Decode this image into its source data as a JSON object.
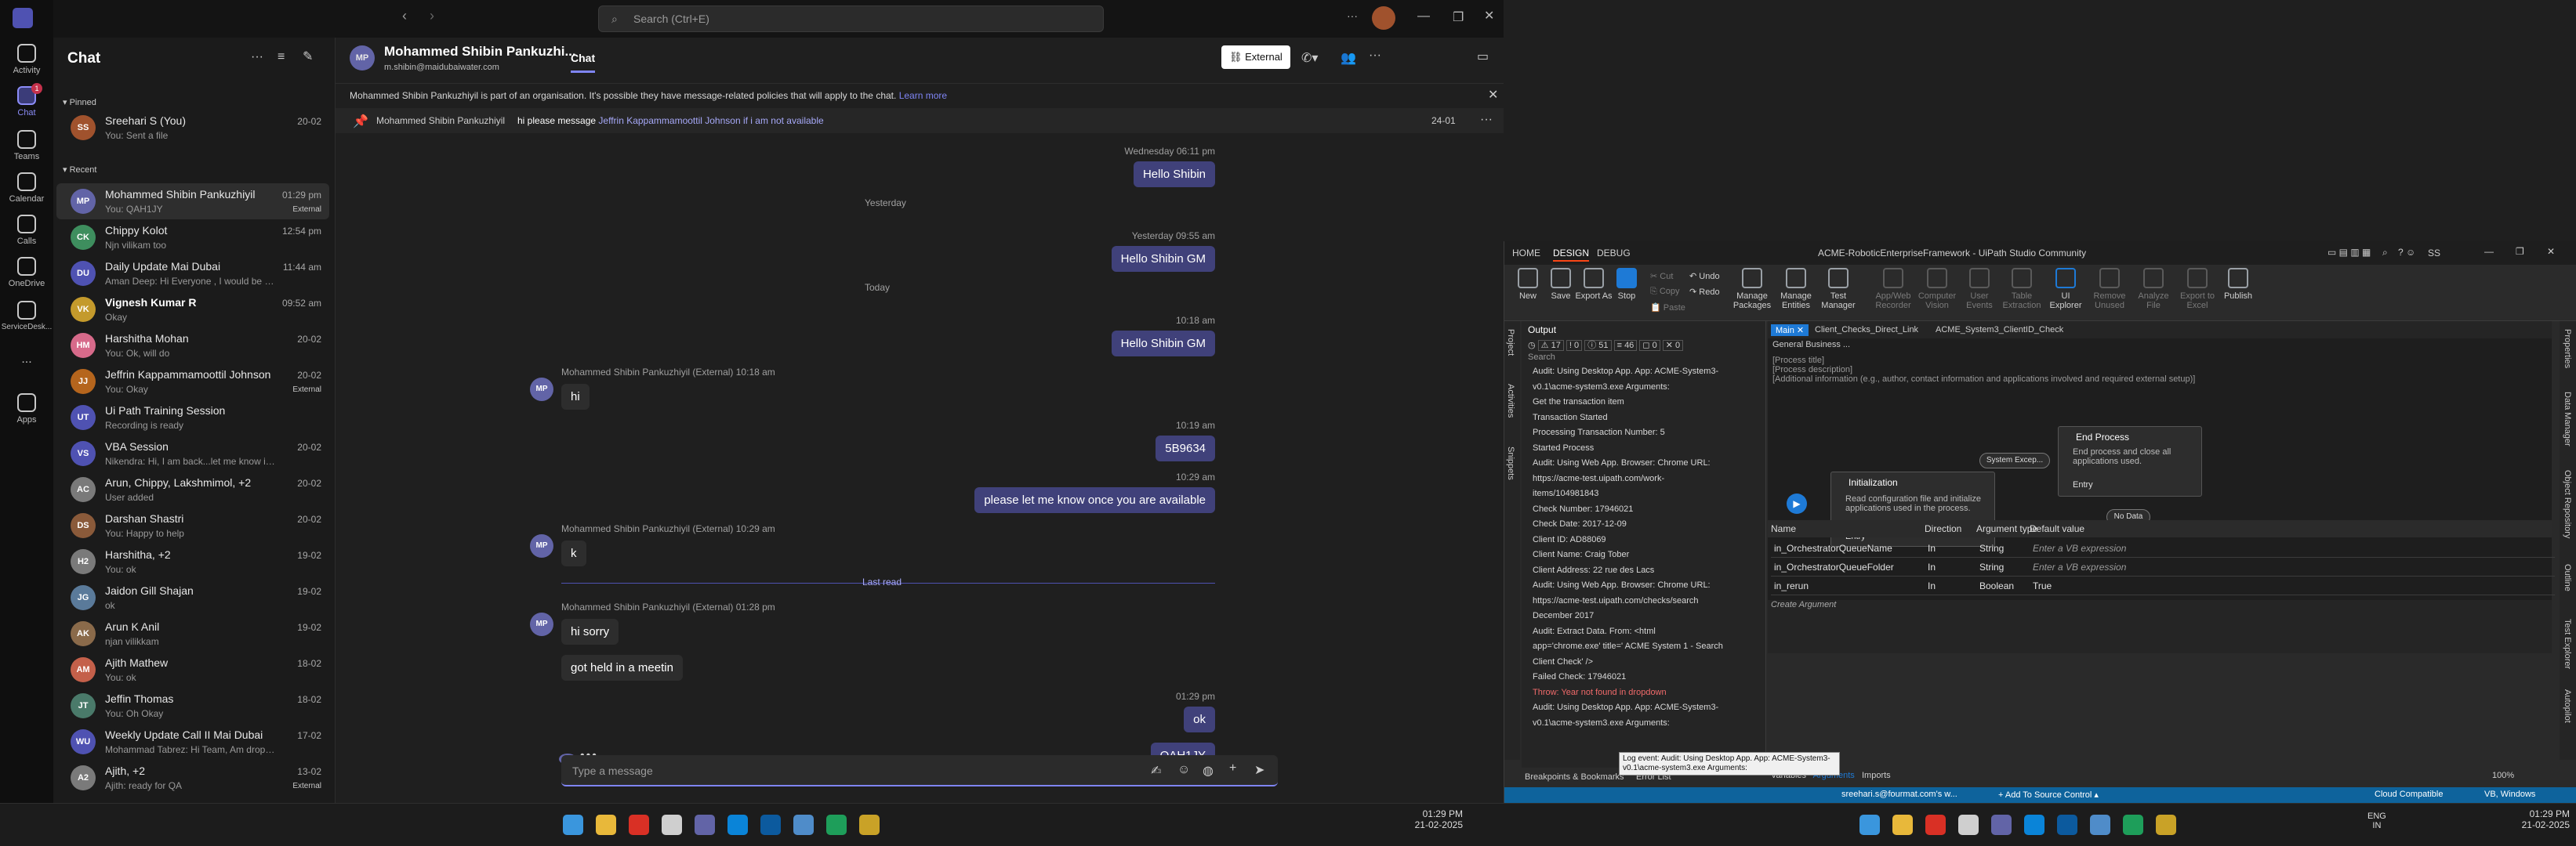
{
  "teams": {
    "search_placeholder": "Search (Ctrl+E)",
    "rail": [
      {
        "label": "Activity",
        "icon": "bell-icon"
      },
      {
        "label": "Chat",
        "icon": "chat-icon",
        "active": true,
        "badge": "1"
      },
      {
        "label": "Teams",
        "icon": "teams-icon"
      },
      {
        "label": "Calendar",
        "icon": "calendar-icon"
      },
      {
        "label": "Calls",
        "icon": "phone-icon"
      },
      {
        "label": "OneDrive",
        "icon": "cloud-icon"
      },
      {
        "label": "ServiceDesk...",
        "icon": "servicedesk-icon"
      },
      {
        "label": "...",
        "icon": "more-icon"
      },
      {
        "label": "Apps",
        "icon": "apps-icon"
      }
    ],
    "chat_header": "Chat",
    "pinned_label": "Pinned",
    "recent_label": "Recent",
    "chats": [
      {
        "name": "Sreehari S (You)",
        "preview": "You: Sent a file",
        "time": "20-02",
        "initials": "SS",
        "color": "#a0522d",
        "bold": false
      },
      {
        "name": "Mohammed Shibin Pankuzhiyil",
        "preview": "You: QAH1JY",
        "time": "01:29 pm",
        "initials": "MP",
        "color": "#6264a7",
        "bold": false,
        "badge": "External",
        "selected": true
      },
      {
        "name": "Chippy Kolot",
        "preview": "Njn vilikam too",
        "time": "12:54 pm",
        "initials": "CK",
        "color": "#3e8e5e",
        "bold": false
      },
      {
        "name": "Daily Update Mai Dubai",
        "preview": "Aman Deep: Hi Everyone , I would be on leave f...",
        "time": "11:44 am",
        "initials": "DU",
        "color": "#4f52b2",
        "bold": false
      },
      {
        "name": "Vignesh Kumar R",
        "preview": "Okay",
        "time": "09:52 am",
        "initials": "VK",
        "color": "#c49a2c",
        "bold": true
      },
      {
        "name": "Harshitha Mohan",
        "preview": "You: Ok, will do",
        "time": "20-02",
        "initials": "HM",
        "color": "#d76a8a",
        "bold": false
      },
      {
        "name": "Jeffrin Kappammamoottil Johnson",
        "preview": "You: Okay",
        "time": "20-02",
        "initials": "JJ",
        "color": "#b5651d",
        "bold": false,
        "badge": "External"
      },
      {
        "name": "Ui Path Training Session",
        "preview": "Recording is ready",
        "time": "",
        "initials": "UT",
        "color": "#4f52b2",
        "bold": false
      },
      {
        "name": "VBA Session",
        "preview": "Nikendra: Hi, I am back...let me know if I am av...",
        "time": "20-02",
        "initials": "VS",
        "color": "#4f52b2",
        "bold": false
      },
      {
        "name": "Arun, Chippy, Lakshmimol, +2",
        "preview": "User added",
        "time": "20-02",
        "initials": "AC",
        "color": "#7a7a7a",
        "bold": false
      },
      {
        "name": "Darshan Shastri",
        "preview": "You: Happy to help",
        "time": "20-02",
        "initials": "DS",
        "color": "#8a5a3a",
        "bold": false
      },
      {
        "name": "Harshitha, +2",
        "preview": "You: ok",
        "time": "19-02",
        "initials": "H2",
        "color": "#7a7a7a",
        "bold": false
      },
      {
        "name": "Jaidon Gill Shajan",
        "preview": "ok",
        "time": "19-02",
        "initials": "JG",
        "color": "#5a7a9a",
        "bold": false
      },
      {
        "name": "Arun K Anil",
        "preview": "njan vilikkam",
        "time": "19-02",
        "initials": "AK",
        "color": "#8a6a4a",
        "bold": false
      },
      {
        "name": "Ajith Mathew",
        "preview": "You: ok",
        "time": "18-02",
        "initials": "AM",
        "color": "#c4604a",
        "bold": false
      },
      {
        "name": "Jeffin Thomas",
        "preview": "You: Oh Okay",
        "time": "18-02",
        "initials": "JT",
        "color": "#4a7a6a",
        "bold": false
      },
      {
        "name": "Weekly Update Call II Mai Dubai",
        "preview": "Mohammad Tabrez: Hi Team, Am dropping fro...",
        "time": "17-02",
        "initials": "WU",
        "color": "#4f52b2",
        "bold": false
      },
      {
        "name": "Ajith, +2",
        "preview": "Ajith: ready for QA",
        "time": "13-02",
        "initials": "A2",
        "color": "#7a7a7a",
        "bold": false,
        "badge": "External"
      }
    ],
    "conv": {
      "name": "Mohammed Shibin Pankuzhi...",
      "email": "m.shibin@maidubaiwater.com",
      "tab": "Chat",
      "external_btn": "External",
      "notice": "Mohammed Shibin Pankuzhiyil is part of an organisation. It's possible they have message-related policies that will apply to the chat.",
      "notice_link": "Learn more",
      "pinned_author": "Mohammed Shibin Pankuzhiyil",
      "pinned_text": "hi please message",
      "pinned_mention": "Jeffrin Kappammamoottil Johnson if i am not available",
      "pinned_date": "24-01",
      "compose_placeholder": "Type a message",
      "messages": [
        {
          "kind": "meta",
          "text": "Wednesday 06:11 pm"
        },
        {
          "kind": "me",
          "text": "Hello Shibin"
        },
        {
          "kind": "day",
          "text": "Yesterday"
        },
        {
          "kind": "meta",
          "text": "Yesterday 09:55 am"
        },
        {
          "kind": "me",
          "text": "Hello Shibin GM"
        },
        {
          "kind": "day",
          "text": "Today"
        },
        {
          "kind": "meta",
          "text": "10:18 am"
        },
        {
          "kind": "me",
          "text": "Hello Shibin GM"
        },
        {
          "kind": "them_meta",
          "text": "Mohammed Shibin Pankuzhiyil (External)  10:18 am"
        },
        {
          "kind": "them",
          "text": "hi"
        },
        {
          "kind": "meta",
          "text": "10:19 am"
        },
        {
          "kind": "me",
          "text": "5B9634"
        },
        {
          "kind": "meta",
          "text": "10:29 am"
        },
        {
          "kind": "me",
          "text": "please let me know once you are available"
        },
        {
          "kind": "them_meta",
          "text": "Mohammed Shibin Pankuzhiyil (External)  10:29 am"
        },
        {
          "kind": "them",
          "text": "k"
        },
        {
          "kind": "lastread",
          "text": "Last read"
        },
        {
          "kind": "them_meta",
          "text": "Mohammed Shibin Pankuzhiyil (External)  01:28 pm"
        },
        {
          "kind": "them",
          "text": "hi sorry"
        },
        {
          "kind": "them",
          "text": "got held in a meetin"
        },
        {
          "kind": "meta",
          "text": "01:29 pm"
        },
        {
          "kind": "me",
          "text": "ok"
        },
        {
          "kind": "me",
          "text": "QAH1JY"
        }
      ]
    }
  },
  "uipath": {
    "title": "ACME-RoboticEnterpriseFramework - UiPath Studio Community",
    "menu": [
      "HOME",
      "DESIGN",
      "DEBUG"
    ],
    "active_menu": "DESIGN",
    "user": "SS",
    "ribbon": [
      "New",
      "Save",
      "Export As",
      "Stop",
      "Cut",
      "Copy",
      "Paste",
      "Undo",
      "Redo",
      "Manage Packages",
      "Manage Entities",
      "Test Manager",
      "App/Web Recorder",
      "Computer Vision",
      "User Events",
      "Table Extraction",
      "UI Explorer",
      "Remove Unused",
      "Analyze File",
      "Export to Excel",
      "Publish"
    ],
    "left_tabs": [
      "Project",
      "Activities",
      "Snippets"
    ],
    "output_title": "Output",
    "output_counts": [
      "17",
      "0",
      "51",
      "46",
      "0",
      "0"
    ],
    "search_label": "Search",
    "output_lines": [
      "Audit: Using Desktop App. App: ACME-System3-",
      "v0.1\\acme-system3.exe Arguments:",
      "Get the transaction item",
      "Transaction Started",
      "Processing Transaction Number: 5",
      "Started Process",
      "Audit: Using Web App. Browser: Chrome URL:",
      "https://acme-test.uipath.com/work-",
      "items/104981843",
      "Check Number: 17946021",
      "Check Date: 2017-12-09",
      "Client ID: AD88069",
      "Client Name: Craig Tober",
      "Client Address:  22 rue des Lacs",
      "Audit: Using Web App. Browser: Chrome URL:",
      "https://acme-test.uipath.com/checks/search",
      "December 2017",
      "Audit: Extract Data. From: <html",
      "app='chrome.exe' title=' ACME System 1 - Search",
      "Client Check' />",
      "Failed Check: 17946021",
      "Throw: Year not found in dropdown",
      "Audit: Using Desktop App. App: ACME-System3-",
      "v0.1\\acme-system3.exe Arguments:"
    ],
    "doc_tabs": [
      "Main",
      "Client_Checks_Direct_Link",
      "ACME_System3_ClientID_Check"
    ],
    "breadcrumb": "General Business ...",
    "annotation_lines": [
      "[Process title]",
      "[Process description]",
      "[Additional information (e.g., author, contact information and applications involved and required external setup)]"
    ],
    "states": {
      "init_title": "Initialization",
      "init_desc": "Read configuration file and initialize applications used in the process.",
      "entry": "Entry",
      "end_title": "End Process",
      "end_desc": "End process and close all applications used.",
      "end_entry": "Entry",
      "sys_exc": "System Excep...",
      "no_data": "No Data"
    },
    "args_headers": [
      "Name",
      "Direction",
      "Argument type",
      "Default value"
    ],
    "args": [
      {
        "name": "in_OrchestratorQueueName",
        "dir": "In",
        "type": "String",
        "default": "Enter a VB expression"
      },
      {
        "name": "in_OrchestratorQueueFolder",
        "dir": "In",
        "type": "String",
        "default": "Enter a VB expression"
      },
      {
        "name": "in_rerun",
        "dir": "In",
        "type": "Boolean",
        "default": "True"
      }
    ],
    "create_argument": "Create Argument",
    "bottom_tabs": [
      "Variables",
      "Arguments",
      "Imports"
    ],
    "zoom": "100%",
    "panel_tabs": [
      "Breakpoints & Bookmarks",
      "Error List"
    ],
    "tooltip": "Log event: Audit: Using Desktop App. App: ACME-System3-v0.1\\acme-system3.exe Arguments:",
    "right_tabs": [
      "Properties",
      "Data Manager",
      "Object Repository",
      "Outline",
      "Test Explorer",
      "Autopilot"
    ],
    "status": {
      "account": "sreehari.s@fourmat.com's w...",
      "source": "Add To Source Control",
      "compat": "Cloud Compatible",
      "lang": "VB, Windows"
    }
  },
  "taskbar": {
    "left_time": "01:29 PM",
    "left_date": "21-02-2025",
    "right_time": "01:29 PM",
    "right_date": "21-02-2025",
    "lang": "ENG",
    "region": "IN"
  }
}
